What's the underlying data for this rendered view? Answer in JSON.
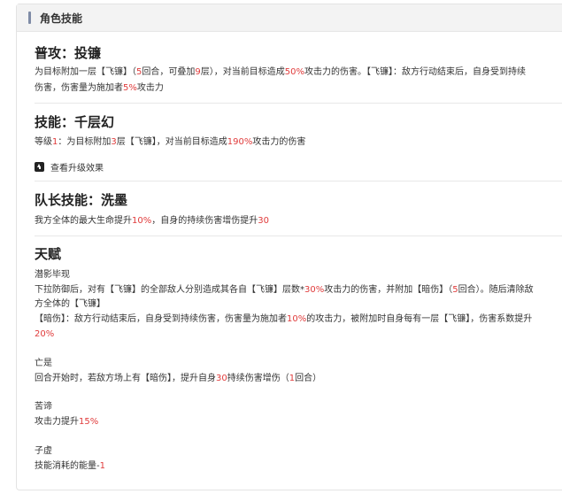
{
  "panel": {
    "title": "角色技能"
  },
  "attack": {
    "title": "普攻：投镰",
    "l1a": "为目标附加一层【飞镰】（",
    "l1b": "5",
    "l1c": "回合，可叠加",
    "l1d": "9",
    "l1e": "层），对当前目标造成",
    "l1f": "50%",
    "l1g": "攻击力的伤害。【飞镰】：敌方行动结束后，自身受到持续",
    "l2a": "伤害，伤害量为施加者",
    "l2b": "5%",
    "l2c": "攻击力"
  },
  "skill": {
    "title": "技能：千层幻",
    "l1a": "等级",
    "l1b": "1",
    "l1c": "：为目标附加",
    "l1d": "3",
    "l1e": "层【飞镰】，对当前目标造成",
    "l1f": "190%",
    "l1g": "攻击力的伤害",
    "upgrade": "查看升级效果"
  },
  "leader": {
    "title": "队长技能：洗墨",
    "l1a": "我方全体的最大生命提升",
    "l1b": "10%",
    "l1c": "，自身的持续伤害增伤提升",
    "l1d": "30"
  },
  "talent": {
    "title": "天赋",
    "t1_name": "潜影毕现",
    "t1_l1a": "下拉防御后，对有【飞镰】的全部敌人分别造成其各自【飞镰】层数*",
    "t1_l1b": "30%",
    "t1_l1c": "攻击力的伤害，并附加【暗伤】（",
    "t1_l1d": "5",
    "t1_l1e": "回合）。随后清除敌",
    "t1_l2": "方全体的【飞镰】",
    "t1_l3a": "【暗伤】：敌方行动结束后，自身受到持续伤害，伤害量为施加者",
    "t1_l3b": "10%",
    "t1_l3c": "的攻击力，被附加时自身每有一层【飞镰】，伤害系数提升",
    "t1_l4": "20%",
    "t2_name": "亡是",
    "t2_l1a": "回合开始时，若敌方场上有【暗伤】，提升自身",
    "t2_l1b": "30",
    "t2_l1c": "持续伤害增伤（",
    "t2_l1d": "1",
    "t2_l1e": "回合）",
    "t3_name": "苦谛",
    "t3_l1a": "攻击力提升",
    "t3_l1b": "15%",
    "t4_name": "子虚",
    "t4_l1a": "技能消耗的能量-",
    "t4_l1b": "1"
  }
}
